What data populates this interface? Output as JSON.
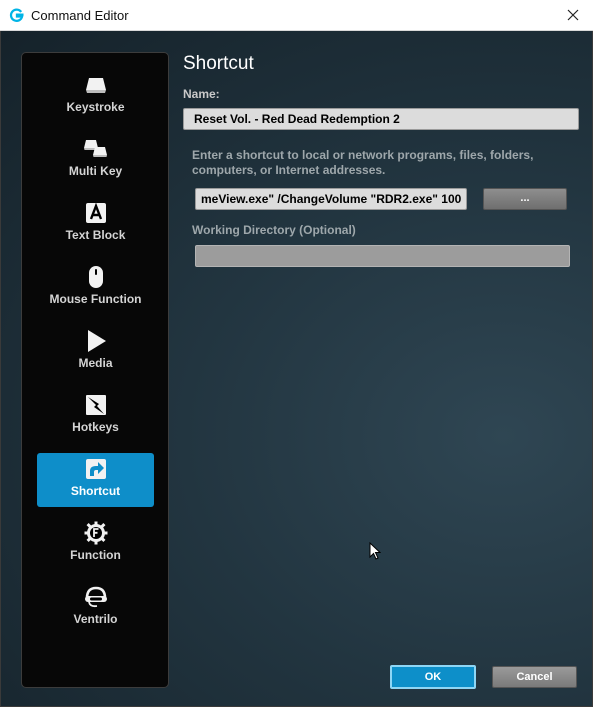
{
  "window": {
    "title": "Command Editor"
  },
  "sidebar": {
    "items": [
      {
        "label": "Keystroke",
        "icon": "keystroke-icon"
      },
      {
        "label": "Multi Key",
        "icon": "multi-key-icon"
      },
      {
        "label": "Text Block",
        "icon": "text-block-icon"
      },
      {
        "label": "Mouse Function",
        "icon": "mouse-icon"
      },
      {
        "label": "Media",
        "icon": "play-icon"
      },
      {
        "label": "Hotkeys",
        "icon": "hotkeys-icon"
      },
      {
        "label": "Shortcut",
        "icon": "shortcut-arrow-icon",
        "active": true
      },
      {
        "label": "Function",
        "icon": "function-gear-icon"
      },
      {
        "label": "Ventrilo",
        "icon": "ventrilo-headset-icon"
      }
    ]
  },
  "main": {
    "heading": "Shortcut",
    "name_label": "Name:",
    "name_value": "Reset Vol. - Red Dead Redemption 2",
    "description": "Enter a shortcut to local or network programs, files, folders, computers, or Internet addresses.",
    "path_value": "meView.exe\" /ChangeVolume \"RDR2.exe\" 100",
    "browse_label": "...",
    "working_dir_label": "Working Directory (Optional)",
    "working_dir_value": ""
  },
  "footer": {
    "ok_label": "OK",
    "cancel_label": "Cancel"
  },
  "colors": {
    "accent": "#0e8ec9",
    "sidebar_bg": "#070707",
    "window_bg": "#1b2a31"
  }
}
